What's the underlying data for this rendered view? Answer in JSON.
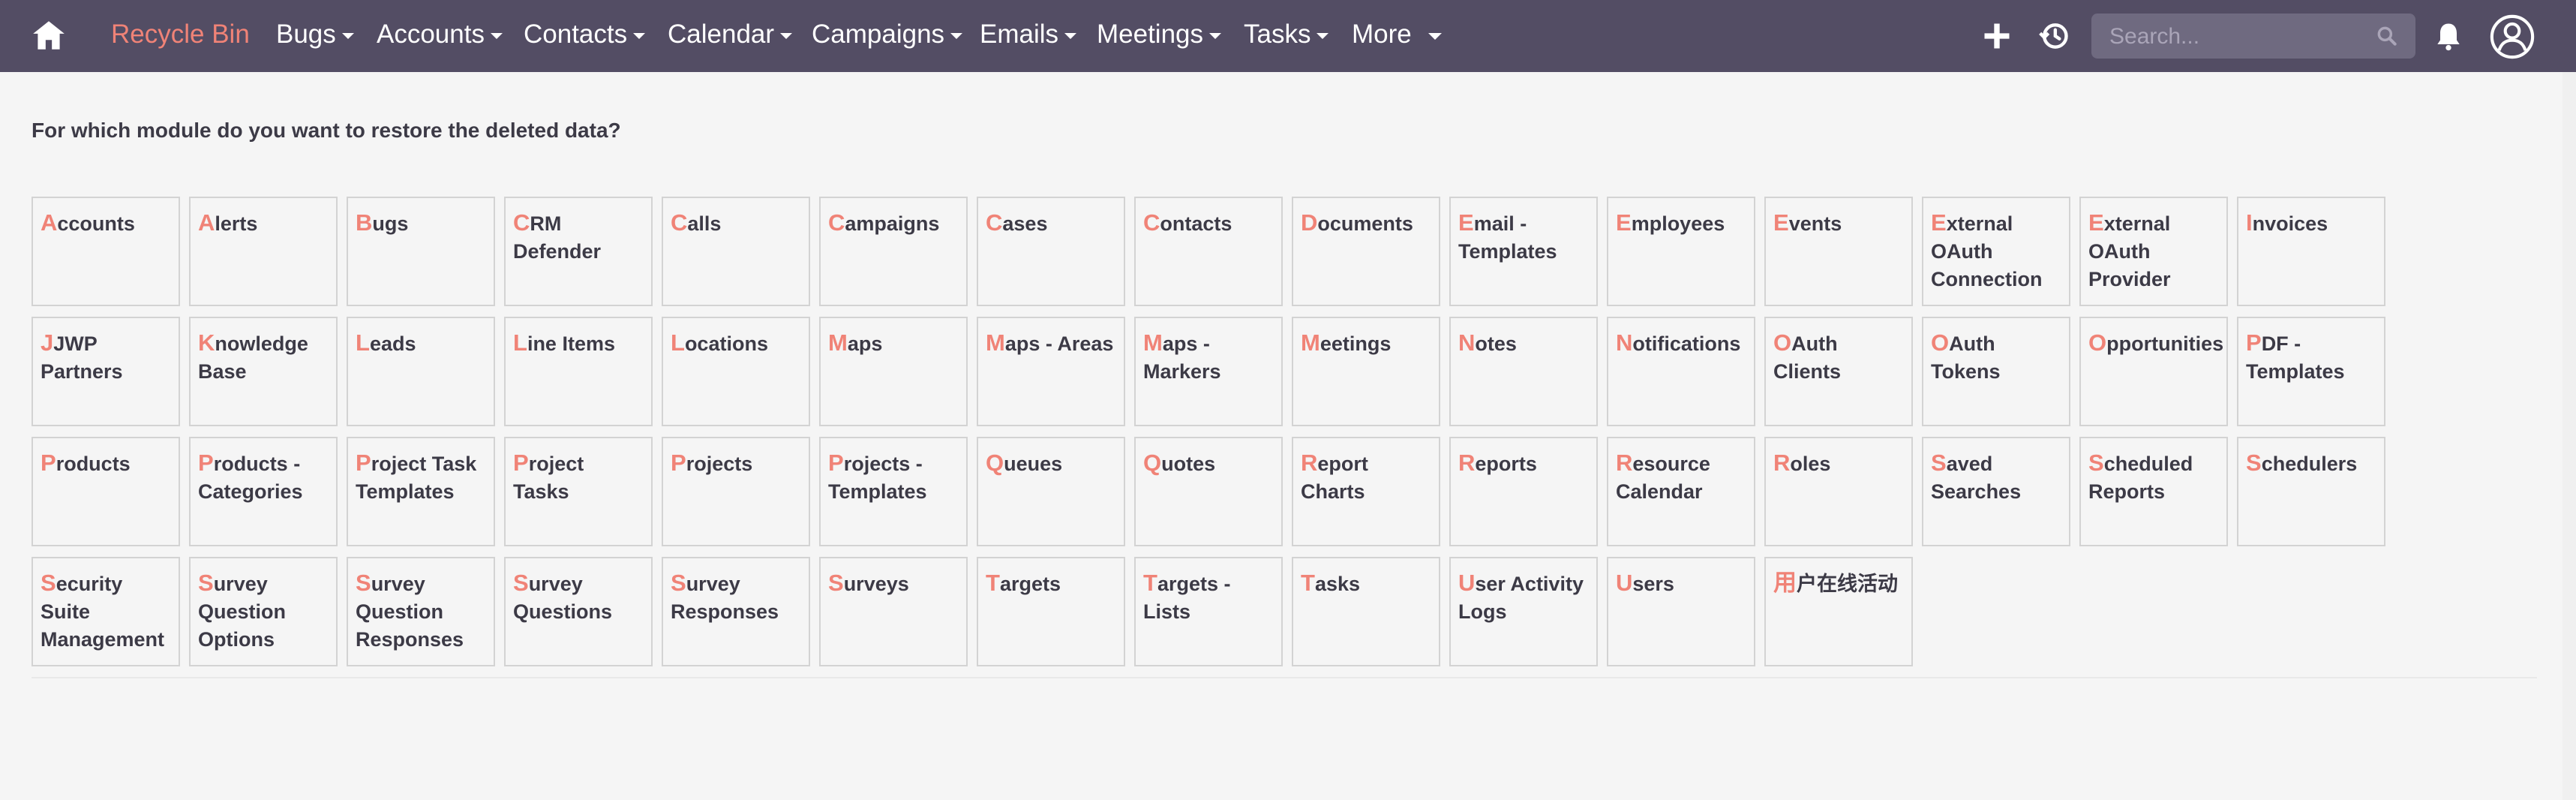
{
  "nav": {
    "brand": "Recycle Bin",
    "items": [
      "Bugs",
      "Accounts",
      "Contacts",
      "Calendar",
      "Campaigns",
      "Emails",
      "Meetings",
      "Tasks"
    ],
    "more": "More",
    "icons": [
      "home-icon",
      "plus-icon",
      "history-icon",
      "search-icon",
      "bell-icon",
      "user-profile-icon"
    ],
    "search_placeholder": "Search..."
  },
  "prompt": "For which module do you want to restore the deleted data?",
  "modules": [
    [
      "A",
      "ccounts"
    ],
    [
      "A",
      "lerts"
    ],
    [
      "B",
      "ugs"
    ],
    [
      "C",
      "RM Defender"
    ],
    [
      "C",
      "alls"
    ],
    [
      "C",
      "ampaigns"
    ],
    [
      "C",
      "ases"
    ],
    [
      "C",
      "ontacts"
    ],
    [
      "D",
      "ocuments"
    ],
    [
      "E",
      "mail - Templates"
    ],
    [
      "E",
      "mployees"
    ],
    [
      "E",
      "vents"
    ],
    [
      "E",
      "xternal OAuth Connection"
    ],
    [
      "E",
      "xternal OAuth Provider"
    ],
    [
      "I",
      "nvoices"
    ],
    [
      "J",
      "JWP Partners"
    ],
    [
      "K",
      "nowledge Base"
    ],
    [
      "L",
      "eads"
    ],
    [
      "L",
      "ine Items"
    ],
    [
      "L",
      "ocations"
    ],
    [
      "M",
      "aps"
    ],
    [
      "M",
      "aps - Areas"
    ],
    [
      "M",
      "aps - Markers"
    ],
    [
      "M",
      "eetings"
    ],
    [
      "N",
      "otes"
    ],
    [
      "N",
      "otifications"
    ],
    [
      "O",
      "Auth Clients"
    ],
    [
      "O",
      "Auth Tokens"
    ],
    [
      "O",
      "pportunities"
    ],
    [
      "P",
      "DF - Templates"
    ],
    [
      "P",
      "roducts"
    ],
    [
      "P",
      "roducts - Categories"
    ],
    [
      "P",
      "roject Task Templates"
    ],
    [
      "P",
      "roject Tasks"
    ],
    [
      "P",
      "rojects"
    ],
    [
      "P",
      "rojects - Templates"
    ],
    [
      "Q",
      "ueues"
    ],
    [
      "Q",
      "uotes"
    ],
    [
      "R",
      "eport Charts"
    ],
    [
      "R",
      "eports"
    ],
    [
      "R",
      "esource Calendar"
    ],
    [
      "R",
      "oles"
    ],
    [
      "S",
      "aved Searches"
    ],
    [
      "S",
      "cheduled Reports"
    ],
    [
      "S",
      "chedulers"
    ],
    [
      "S",
      "ecurity Suite Management"
    ],
    [
      "S",
      "urvey Question Options"
    ],
    [
      "S",
      "urvey Question Responses"
    ],
    [
      "S",
      "urvey Questions"
    ],
    [
      "S",
      "urvey Responses"
    ],
    [
      "S",
      "urveys"
    ],
    [
      "T",
      "argets"
    ],
    [
      "T",
      "argets - Lists"
    ],
    [
      "T",
      "asks"
    ],
    [
      "U",
      "ser Activity Logs"
    ],
    [
      "U",
      "sers"
    ],
    [
      "用",
      "户在线活动"
    ]
  ],
  "colors": {
    "topbar": "#534d64",
    "accent": "#f08377",
    "text": "#3c3a46",
    "border": "#d3d3d3"
  }
}
